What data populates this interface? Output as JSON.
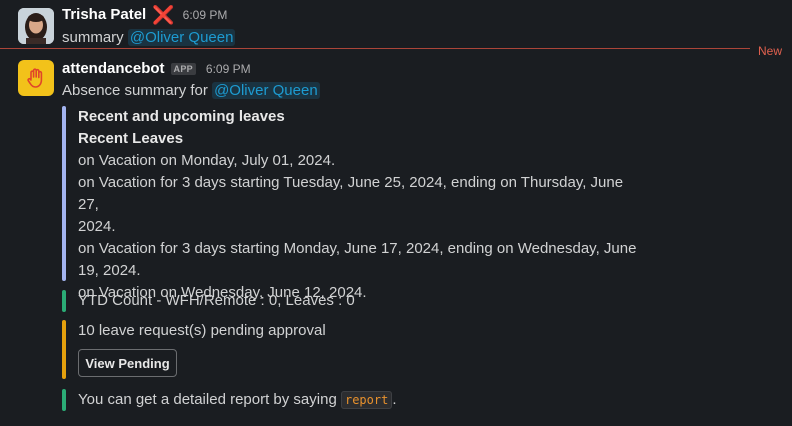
{
  "message1": {
    "author": "Trisha Patel",
    "status_emoji": "❌",
    "time": "6:09 PM",
    "text": "summary",
    "mention": "@Oliver Queen"
  },
  "divider": {
    "label": "New"
  },
  "message2": {
    "author": "attendancebot",
    "badge": "APP",
    "time": "6:09 PM",
    "text": "Absence summary for",
    "mention": "@Oliver Queen"
  },
  "leaves": {
    "heading": "Recent and upcoming leaves",
    "subheading": "Recent Leaves",
    "lines": [
      "on Vacation on Monday, July 01, 2024.",
      "on Vacation for 3 days starting Tuesday, June 25, 2024, ending on Thursday, June 27,",
      "2024.",
      "on Vacation for 3 days starting Monday, June 17, 2024, ending on Wednesday, June",
      "19, 2024.",
      "on Vacation on Wednesday, June 12, 2024."
    ]
  },
  "ytd": {
    "text": "YTD Count - WFH/Remote : 0, Leaves : 0"
  },
  "pending": {
    "text": "10 leave request(s) pending approval",
    "button": "View Pending"
  },
  "report": {
    "text_before": "You can get a detailed report by saying",
    "code": "report",
    "text_after": "."
  },
  "colors": {
    "bar_leaves": "#a3b4f0",
    "bar_ytd": "#2bac76",
    "bar_pending": "#e5a00d",
    "bar_report": "#2bac76",
    "mention": "#1d9bd1"
  }
}
